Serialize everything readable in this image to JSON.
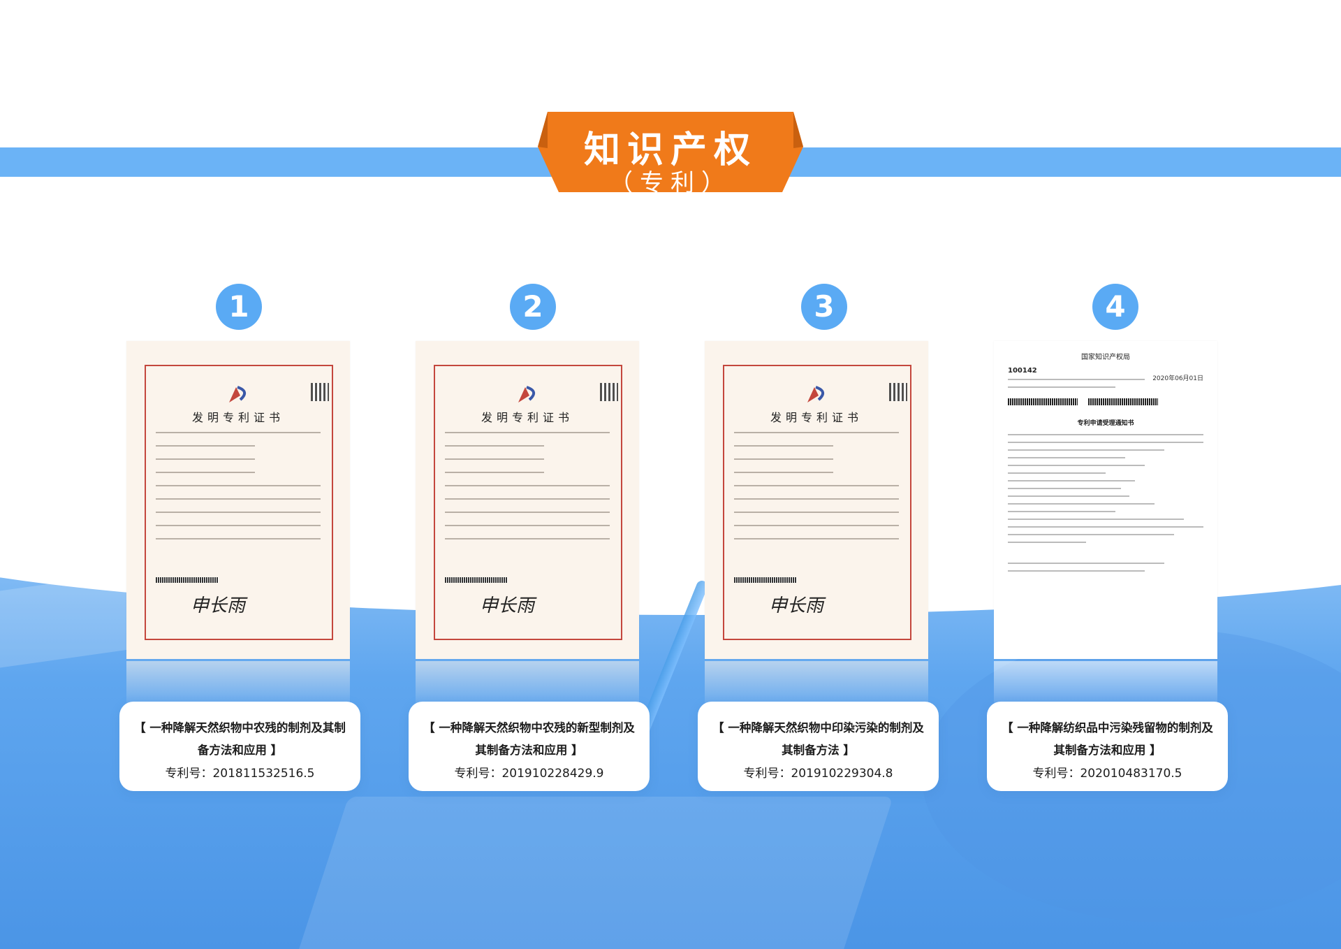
{
  "header": {
    "title": "知识产权",
    "subtitle": "（专利）"
  },
  "colors": {
    "band": "#6bb3f6",
    "tab": "#f07a1a",
    "number_circle": "#5aaaf4",
    "cert_border": "#c4473d"
  },
  "certificate": {
    "title": "发明专利证书",
    "signature": "申长雨"
  },
  "patents": [
    {
      "number": "1",
      "title": "【 一种降解天然织物中农残的制剂及其制备方法和应用 】",
      "patent_no": "专利号：201811532516.5"
    },
    {
      "number": "2",
      "title": "【 一种降解天然织物中农残的新型制剂及其制备方法和应用 】",
      "patent_no": "专利号：201910228429.9"
    },
    {
      "number": "3",
      "title": "【 一种降解天然织物中印染污染的制剂及其制备方法 】",
      "patent_no": "专利号：201910229304.8"
    },
    {
      "number": "4",
      "title": "【 一种降解纺织品中污染残留物的制剂及其制备方法和应用 】",
      "patent_no": "专利号：202010483170.5"
    }
  ],
  "notice": {
    "office": "国家知识产权局",
    "code": "100142",
    "heading": "专利申请受理通知书",
    "date": "2020年06月01日"
  }
}
